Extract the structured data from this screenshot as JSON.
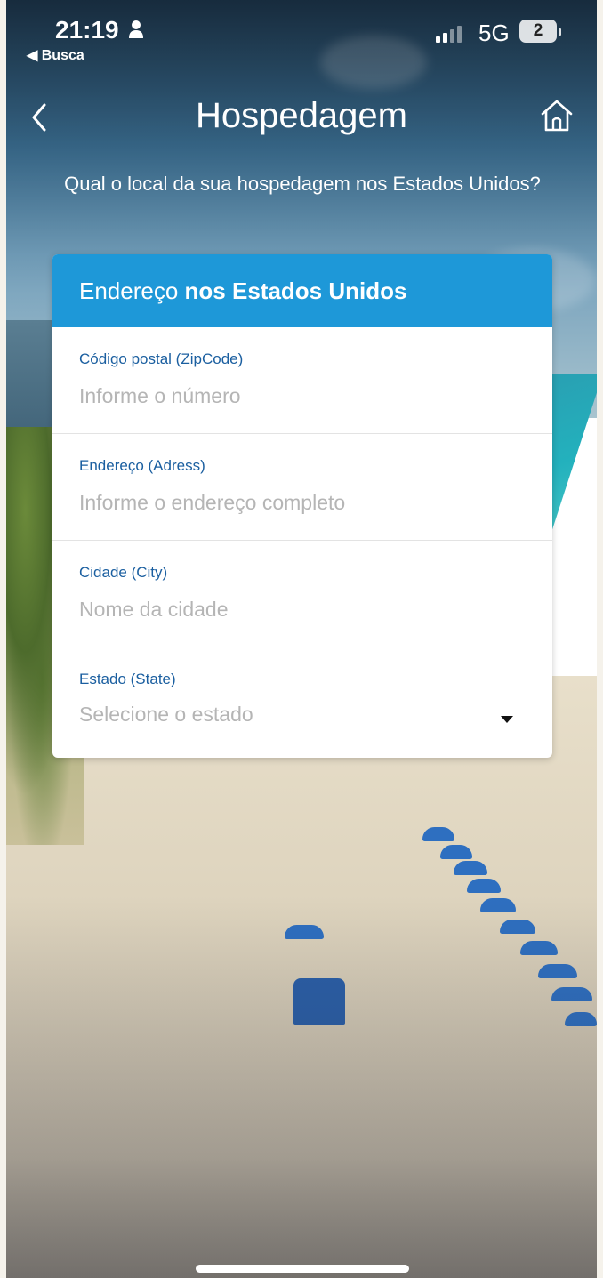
{
  "status_bar": {
    "time": "21:19",
    "back_app": "◀ Busca",
    "network": "5G",
    "battery": "2"
  },
  "nav": {
    "title": "Hospedagem"
  },
  "question": "Qual o local da sua hospedagem nos Estados Unidos?",
  "card": {
    "header_prefix": "Endereço ",
    "header_bold": "nos Estados Unidos",
    "fields": [
      {
        "label": "Código postal (ZipCode)",
        "placeholder": "Informe o número"
      },
      {
        "label": "Endereço (Adress)",
        "placeholder": "Informe o endereço completo"
      },
      {
        "label": "Cidade (City)",
        "placeholder": "Nome da cidade"
      },
      {
        "label": "Estado (State)",
        "placeholder": "Selecione o estado"
      }
    ]
  },
  "colors": {
    "header_blue": "#1e98d8",
    "label_blue": "#1b5fa0",
    "placeholder_gray": "#b5b5b5"
  }
}
